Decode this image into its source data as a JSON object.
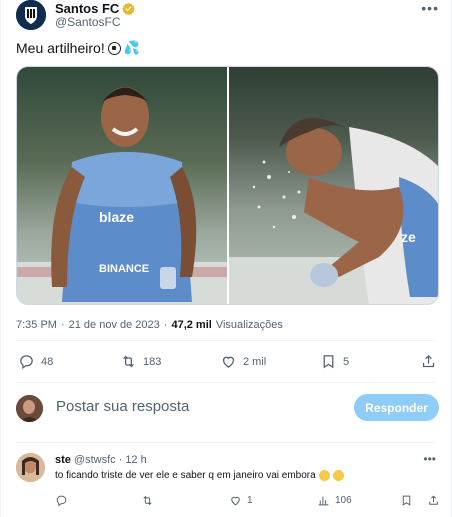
{
  "author": {
    "display_name": "Santos FC",
    "handle": "@SantosFC"
  },
  "tweet": {
    "text": "Meu artilheiro!",
    "emojis": [
      "soccer-ball",
      "sweat-droplets"
    ],
    "time": "7:35 PM",
    "date": "21 de nov de 2023",
    "views_count": "47,2 mil",
    "views_label": "Visualizações"
  },
  "actions": {
    "replies": "48",
    "retweets": "183",
    "likes": "2 mil",
    "bookmarks": "5"
  },
  "reply_box": {
    "placeholder": "Postar sua resposta",
    "button": "Responder"
  },
  "reply": {
    "name": "ste",
    "handle": "@stwsfc",
    "time": "12 h",
    "text": "to ficando triste de ver ele e saber q em janeiro vai embora",
    "emojis": [
      "crying-face",
      "tired-face"
    ],
    "replies": "",
    "retweets": "",
    "likes": "1",
    "views": "106"
  },
  "colors": {
    "accent": "#1d9bf0",
    "reply_button": "#8ecdf7",
    "secondary_text": "#536471"
  }
}
